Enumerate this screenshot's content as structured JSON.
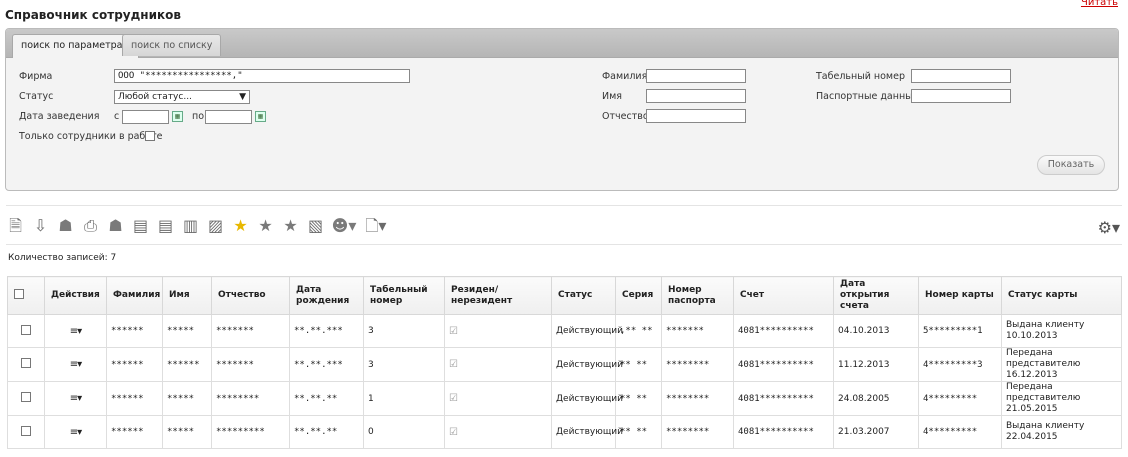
{
  "header": {
    "title": "Справочник сотрудников",
    "read_link": "Читать"
  },
  "tabs": [
    {
      "label": "поиск по параметрам"
    },
    {
      "label": "поиск по списку"
    }
  ],
  "form": {
    "firm_label": "Фирма",
    "firm_value": "ООО \"****************,\"",
    "status_label": "Статус",
    "status_value": "Любой статус...",
    "date_label": "Дата заведения",
    "from_label": "с",
    "to_label": "по",
    "only_active_label": "Только сотрудники в работе",
    "last_name_label": "Фамилия",
    "first_name_label": "Имя",
    "middle_name_label": "Отчество",
    "tab_number_label": "Табельный номер",
    "passport_label": "Паспортные данные",
    "show_button": "Показать"
  },
  "toolbar": {
    "icons": [
      "new-document-icon",
      "download-icon",
      "award-icon",
      "printer-icon",
      "award-dark-icon",
      "card-icon",
      "card-edit-icon",
      "card-swap-icon",
      "cards-stack-icon",
      "star-icon",
      "star-gray-icon",
      "star-edit-icon",
      "card-copy-icon",
      "users-dropdown-icon",
      "document-dropdown-icon"
    ],
    "settings_icon": "gear-icon"
  },
  "records_count": "Количество записей: 7",
  "table": {
    "columns": [
      "",
      "Действия",
      "Фамилия",
      "Имя",
      "Отчество",
      "Дата рождения",
      "Табельный номер",
      "Резиден/нерезидент",
      "Статус",
      "Серия",
      "Номер паспорта",
      "Счет",
      "Дата открытия счета",
      "Номер карты",
      "Статус карты"
    ],
    "rows": [
      {
        "last": "******",
        "first": "*****",
        "middle": "*******",
        "birth": "**.**.***",
        "tab": "3",
        "status": "Действующий",
        "series": ",** **",
        "passport": "*******",
        "account": "4081**********",
        "opened": "04.10.2013",
        "card": "5*********1",
        "card_status": "Выдана клиенту 10.10.2013"
      },
      {
        "last": "******",
        "first": "******",
        "middle": "*******",
        "birth": "**.**.***",
        "tab": "3",
        "status": "Действующий",
        "series": "** **",
        "passport": "********",
        "account": "4081**********",
        "opened": "11.12.2013",
        "card": "4*********3",
        "card_status": "Передана представителю 16.12.2013"
      },
      {
        "last": "******",
        "first": "*****",
        "middle": "********",
        "birth": "**.**.**",
        "tab": "1",
        "status": "Действующий",
        "series": "** **",
        "passport": "********",
        "account": "4081**********",
        "opened": "24.08.2005",
        "card": "4*********",
        "card_status": "Передана представителю 21.05.2015"
      },
      {
        "last": "******",
        "first": "*****",
        "middle": "*********",
        "birth": "**.**.**",
        "tab": "0",
        "status": "Действующий",
        "series": "** **",
        "passport": "********",
        "account": "4081**********",
        "opened": "21.03.2007",
        "card": "4*********",
        "card_status": "Выдана клиенту 22.04.2015"
      }
    ]
  }
}
